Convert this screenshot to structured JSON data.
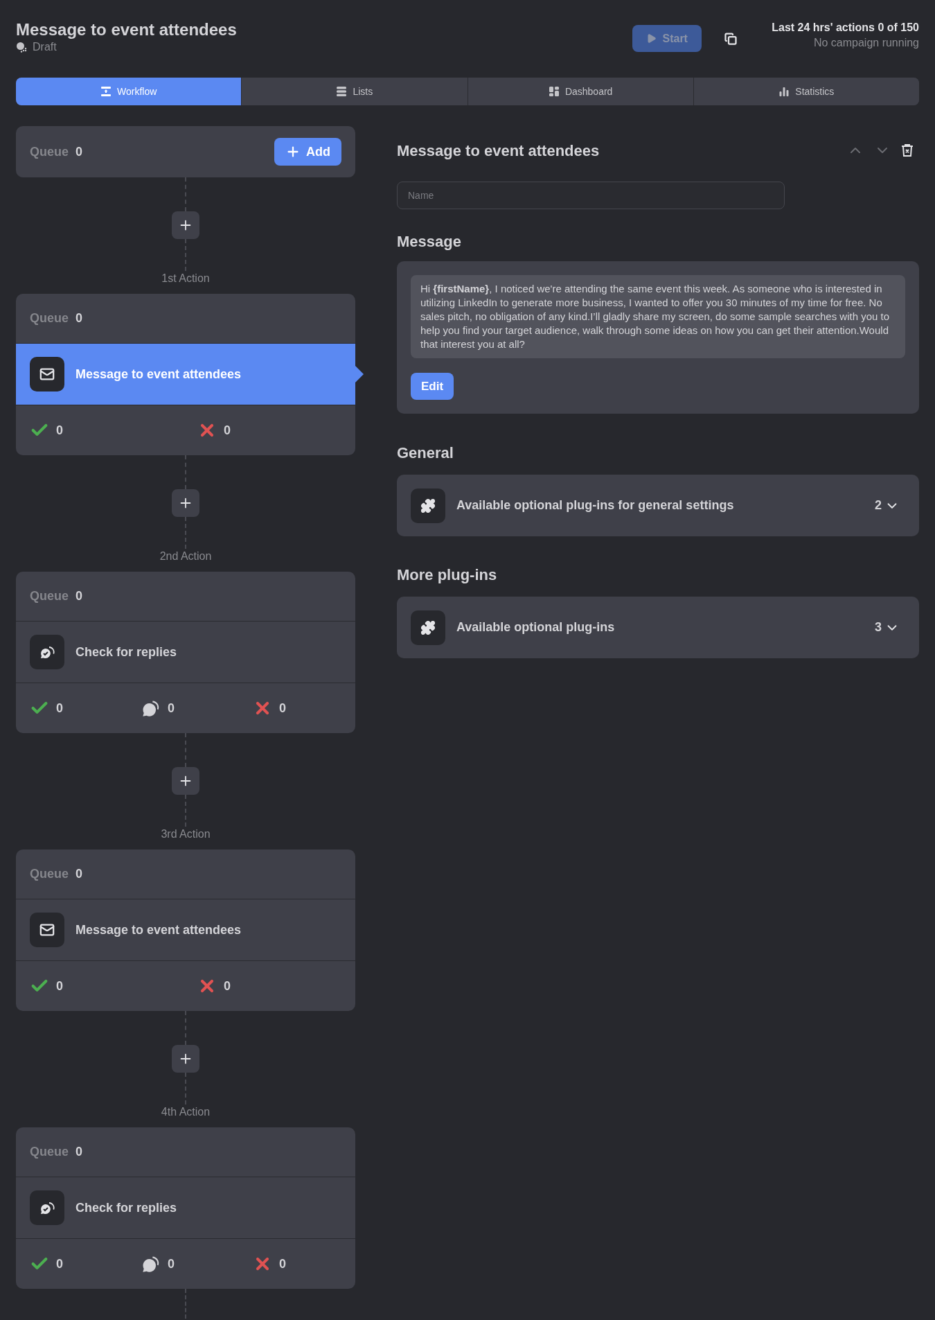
{
  "header": {
    "title": "Message to event attendees",
    "status": "Draft",
    "start_button": {
      "label": "Start",
      "disabled": true
    },
    "quota": "Last 24 hrs' actions 0 of 150",
    "campaign_status": "No campaign running"
  },
  "tabs": [
    {
      "label": "Workflow",
      "selected": true
    },
    {
      "label": "Lists",
      "selected": false
    },
    {
      "label": "Dashboard",
      "selected": false
    },
    {
      "label": "Statistics",
      "selected": false
    }
  ],
  "workflow": {
    "queue": {
      "label": "Queue",
      "count": "0"
    },
    "add_button": "Add",
    "steps": [
      {
        "label": "1st Action",
        "queue_label": "Queue",
        "queue_count": "0",
        "kind": "message",
        "title": "Message to event attendees",
        "selected": true,
        "stats": [
          {
            "kind": "success",
            "count": "0"
          },
          {
            "kind": "fail",
            "count": "0"
          }
        ]
      },
      {
        "label": "2nd Action",
        "queue_label": "Queue",
        "queue_count": "0",
        "kind": "check",
        "title": "Check for replies",
        "selected": false,
        "stats": [
          {
            "kind": "success",
            "count": "0"
          },
          {
            "kind": "reply",
            "count": "0"
          },
          {
            "kind": "fail",
            "count": "0"
          }
        ]
      },
      {
        "label": "3rd Action",
        "queue_label": "Queue",
        "queue_count": "0",
        "kind": "message",
        "title": "Message to event attendees",
        "selected": false,
        "stats": [
          {
            "kind": "success",
            "count": "0"
          },
          {
            "kind": "fail",
            "count": "0"
          }
        ]
      },
      {
        "label": "4th Action",
        "queue_label": "Queue",
        "queue_count": "0",
        "kind": "check",
        "title": "Check for replies",
        "selected": false,
        "stats": [
          {
            "kind": "success",
            "count": "0"
          },
          {
            "kind": "reply",
            "count": "0"
          },
          {
            "kind": "fail",
            "count": "0"
          }
        ]
      }
    ]
  },
  "editor": {
    "title": "Message to event attendees",
    "name_placeholder": "Name",
    "message_heading": "Message",
    "message": "Hi **{firstName}**, I noticed we're attending the same event this week. As someone who is interested in utilizing LinkedIn to generate more business, I wanted to offer you 30 minutes of my time for free. No sales pitch, no obligation of any kind.I’ll gladly share my screen, do some sample searches with you to help you find your target audience, walk through some ideas on how you can get their attention.Would that interest you at all?",
    "edit_button": "Edit",
    "sections": [
      {
        "heading": "General",
        "label": "Available optional plug-ins for general settings",
        "count": "2",
        "expanded": false
      },
      {
        "heading": "More plug-ins",
        "label": "Available optional plug-ins",
        "count": "3",
        "expanded": false
      }
    ]
  }
}
